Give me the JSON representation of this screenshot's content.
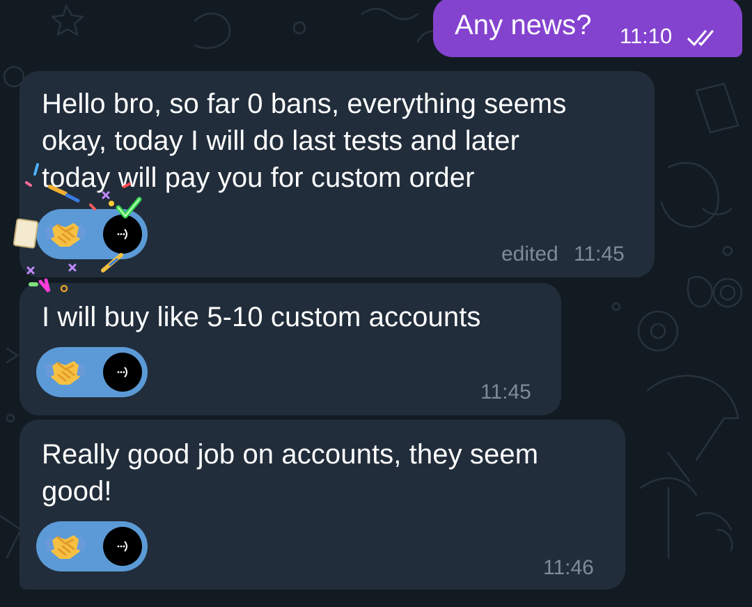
{
  "chat": {
    "messages": [
      {
        "direction": "outgoing",
        "text": "Any news?",
        "time": "11:10",
        "status": "read",
        "status_icon": "double-check-icon"
      },
      {
        "direction": "incoming",
        "lines": [
          "Hello bro, so far 0 bans, everything seems",
          "okay, today I will do last tests and later",
          "today will pay you for custom order"
        ],
        "edited_label": "edited",
        "time": "11:45",
        "reaction": {
          "emoji": "🤝",
          "icon": "handshake-icon",
          "reactor_avatar": "avatar-icon"
        },
        "effect": "confetti"
      },
      {
        "direction": "incoming",
        "lines": [
          "I will buy like 5-10 custom accounts"
        ],
        "time": "11:45",
        "reaction": {
          "emoji": "🤝",
          "icon": "handshake-icon",
          "reactor_avatar": "avatar-icon"
        }
      },
      {
        "direction": "incoming",
        "lines": [
          "Really good job on accounts, they seem",
          "good!"
        ],
        "time": "11:46",
        "reaction": {
          "emoji": "🤝",
          "icon": "handshake-icon",
          "reactor_avatar": "avatar-icon"
        }
      }
    ]
  },
  "colors": {
    "background": "#121b22",
    "incoming_bubble": "#212d3b",
    "outgoing_bubble": "#8443cf",
    "reaction_chip": "#5b9ad6",
    "meta_text": "#7f8b98"
  }
}
